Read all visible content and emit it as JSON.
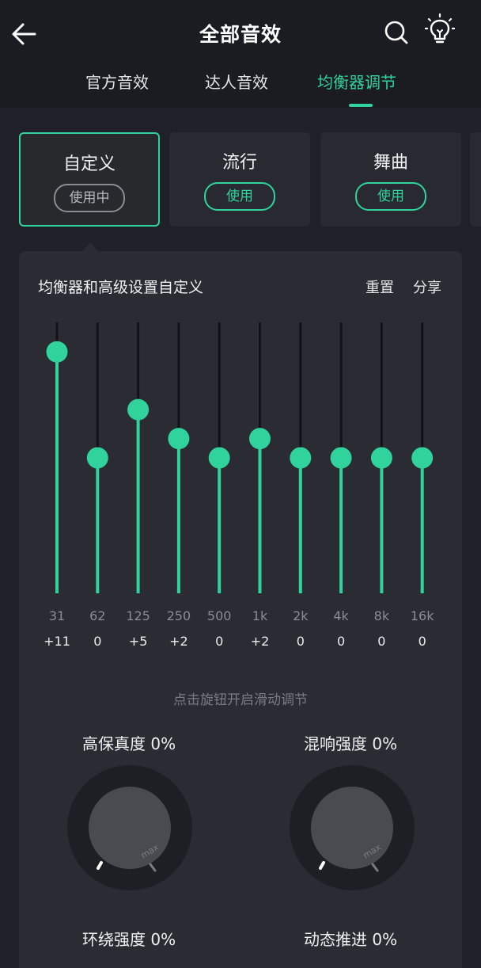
{
  "header": {
    "title": "全部音效",
    "tabs": [
      {
        "label": "官方音效",
        "active": false
      },
      {
        "label": "达人音效",
        "active": false
      },
      {
        "label": "均衡器调节",
        "active": true
      }
    ]
  },
  "presets": [
    {
      "name": "自定义",
      "button": "使用中",
      "active": true
    },
    {
      "name": "流行",
      "button": "使用",
      "active": false
    },
    {
      "name": "舞曲",
      "button": "使用",
      "active": false
    }
  ],
  "equalizer": {
    "title": "均衡器和高级设置自定义",
    "reset_label": "重置",
    "share_label": "分享",
    "gain_range": [
      -12,
      12
    ],
    "bands": [
      {
        "freq": "31",
        "gain": 11,
        "gain_label": "+11"
      },
      {
        "freq": "62",
        "gain": 0,
        "gain_label": "0"
      },
      {
        "freq": "125",
        "gain": 5,
        "gain_label": "+5"
      },
      {
        "freq": "250",
        "gain": 2,
        "gain_label": "+2"
      },
      {
        "freq": "500",
        "gain": 0,
        "gain_label": "0"
      },
      {
        "freq": "1k",
        "gain": 2,
        "gain_label": "+2"
      },
      {
        "freq": "2k",
        "gain": 0,
        "gain_label": "0"
      },
      {
        "freq": "4k",
        "gain": 0,
        "gain_label": "0"
      },
      {
        "freq": "8k",
        "gain": 0,
        "gain_label": "0"
      },
      {
        "freq": "16k",
        "gain": 0,
        "gain_label": "0"
      }
    ],
    "hint": "点击旋钮开启滑动调节"
  },
  "knobs": [
    {
      "label": "高保真度 0%",
      "value": 0,
      "max_label": "max"
    },
    {
      "label": "混响强度 0%",
      "value": 0,
      "max_label": "max"
    },
    {
      "label": "环绕强度 0%",
      "value": 0
    },
    {
      "label": "动态推进 0%",
      "value": 0
    }
  ],
  "colors": {
    "accent": "#2fd39b",
    "background": "#1b1c22",
    "panel": "#2b2c33"
  }
}
